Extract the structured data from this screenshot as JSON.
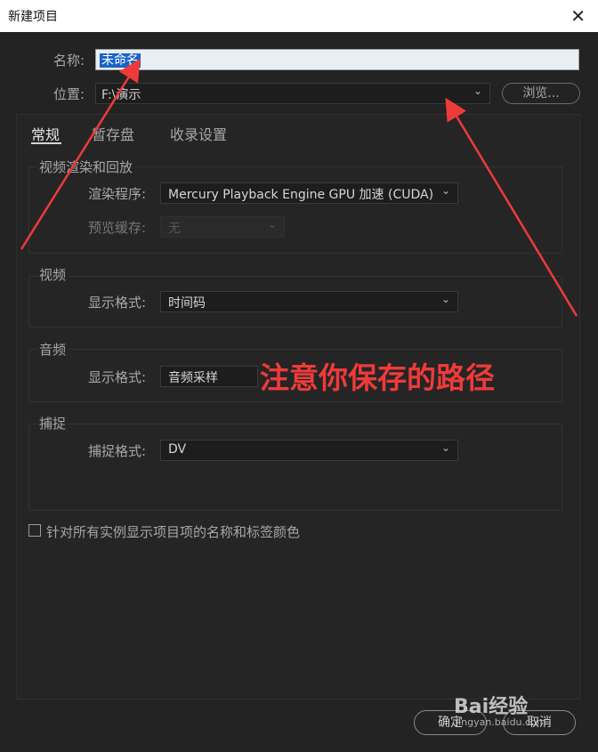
{
  "window": {
    "title": "新建项目",
    "close_label": "✕"
  },
  "name_row": {
    "label": "名称:",
    "value": "未命名"
  },
  "location_row": {
    "label": "位置:",
    "value": "F:\\演示",
    "browse_label": "浏览..."
  },
  "tabs": [
    {
      "label": "常规",
      "active": true
    },
    {
      "label": "暂存盘",
      "active": false
    },
    {
      "label": "收录设置",
      "active": false
    }
  ],
  "video_render": {
    "title": "视频渲染和回放",
    "renderer_label": "渲染程序:",
    "renderer_value": "Mercury Playback Engine GPU 加速 (CUDA)",
    "preview_cache_label": "预览缓存:",
    "preview_cache_value": "无"
  },
  "video": {
    "title": "视频",
    "display_format_label": "显示格式:",
    "display_format_value": "时间码"
  },
  "audio": {
    "title": "音频",
    "display_format_label": "显示格式:",
    "display_format_value": "音频采样"
  },
  "capture": {
    "title": "捕捉",
    "capture_format_label": "捕捉格式:",
    "capture_format_value": "DV"
  },
  "checkbox": {
    "label": "针对所有实例显示项目项的名称和标签颜色",
    "checked": false
  },
  "buttons": {
    "ok": "确定",
    "cancel": "取消"
  },
  "annotation": {
    "text": "注意你保存的路径",
    "color": "#ef3a3a"
  },
  "watermark": {
    "brand": "Bai经验",
    "url": "jingyan.baidu.com"
  },
  "colors": {
    "background": "#232323",
    "selection": "#1a63c8",
    "annotation_red": "#ef3a3a"
  }
}
